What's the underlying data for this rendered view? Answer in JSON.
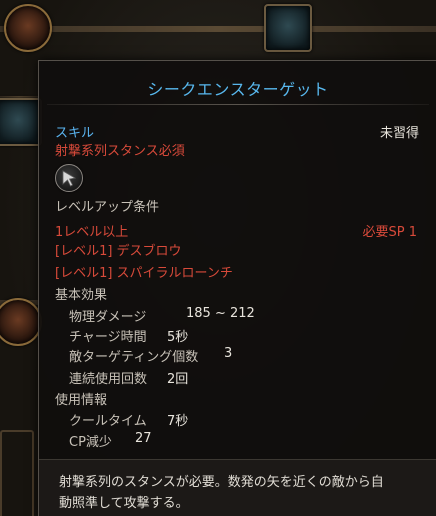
{
  "tooltip": {
    "title": "シークエンスターゲット",
    "skill_type": "スキル",
    "learn_status": "未習得",
    "stance_requirement": "射撃系列スタンス必須",
    "icon": "arrow-cursor-icon",
    "levelup_header": "レベルアップ条件",
    "levelup_level": "1レベル以上",
    "levelup_sp": "必要SP 1",
    "prereqs": [
      "[レベル1] デスブロウ",
      "[レベル1] スパイラルローンチ"
    ],
    "basic_effect_header": "基本効果",
    "basic_effects": [
      {
        "label": "物理ダメージ",
        "value": "185 ~ 212"
      },
      {
        "label": "チャージ時間",
        "value": "5秒"
      },
      {
        "label": "敵ターゲティング個数",
        "value": "3"
      },
      {
        "label": "連続使用回数",
        "value": "2回"
      }
    ],
    "usage_header": "使用情報",
    "usage": [
      {
        "label": "クールタイム",
        "value": "7秒"
      },
      {
        "label": "CP減少",
        "value": "27"
      }
    ],
    "description_lines": [
      "射撃系列のスタンスが必要。数発の矢を近くの敵から自",
      "動照準して攻撃する。"
    ]
  },
  "colors": {
    "title_blue": "#58b8ee",
    "requirement_red": "#d84a3a",
    "label_grey": "#c8c2b8",
    "value_white": "#e8e4dc"
  }
}
